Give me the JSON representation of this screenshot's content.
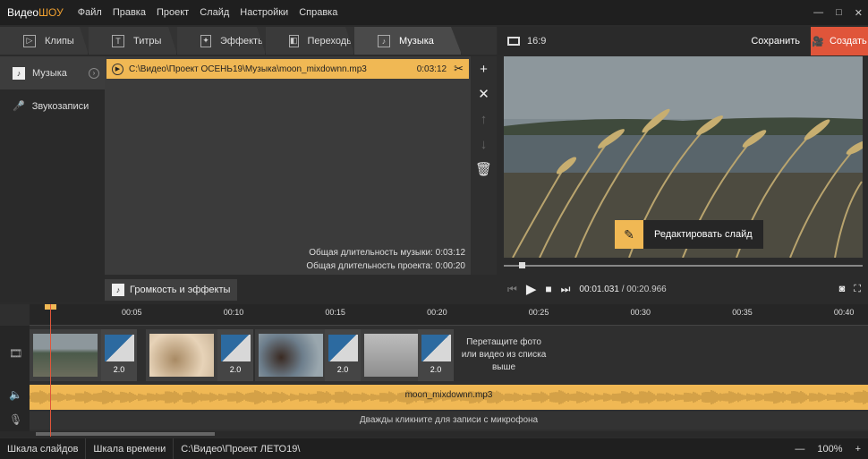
{
  "app": {
    "logo_a": "Видео",
    "logo_b": "ШОУ"
  },
  "menu": [
    "Файл",
    "Правка",
    "Проект",
    "Слайд",
    "Настройки",
    "Справка"
  ],
  "window_controls": [
    "—",
    "□",
    "✕"
  ],
  "tabs": [
    {
      "label": "Клипы",
      "icon": "▷"
    },
    {
      "label": "Титры",
      "icon": "T"
    },
    {
      "label": "Эффекты",
      "icon": "✦"
    },
    {
      "label": "Переходы",
      "icon": "◧"
    },
    {
      "label": "Музыка",
      "icon": "♪"
    }
  ],
  "sidebar": [
    {
      "label": "Музыка",
      "icon": "♪"
    },
    {
      "label": "Звукозаписи",
      "icon": "🎙"
    }
  ],
  "track": {
    "path": "C:\\Видео\\Проект ОСЕНЬ19\\Музыка\\moon_mixdownn.mp3",
    "duration": "0:03:12"
  },
  "totals": {
    "music": "Общая длительность музыки: 0:03:12",
    "project": "Общая длительность проекта: 0:00:20"
  },
  "volume_button": "Громкость и эффекты",
  "preview": {
    "aspect": "16:9",
    "save": "Сохранить",
    "create": "Создать",
    "edit_slide": "Редактировать слайд",
    "time_current": "00:01.031",
    "time_total": "/ 00:20.966",
    "progress": 0.05
  },
  "timeline": {
    "ticks": [
      "00:05",
      "00:10",
      "00:15",
      "00:20",
      "00:25",
      "00:30",
      "00:35",
      "00:40"
    ],
    "transitions": [
      "2.0",
      "2.0",
      "2.0",
      "2.0"
    ],
    "drop_hint": "Перетащите фото или видео из списка выше",
    "audio_label": "moon_mixdownn.mp3",
    "mic_hint": "Дважды кликните для записи с микрофона"
  },
  "statusbar": {
    "slides_scale": "Шкала слайдов",
    "time_scale": "Шкала времени",
    "project_path": "C:\\Видео\\Проект ЛЕТО19\\",
    "zoom": "100%"
  },
  "colors": {
    "accent": "#f0b854",
    "create": "#e0553a"
  }
}
